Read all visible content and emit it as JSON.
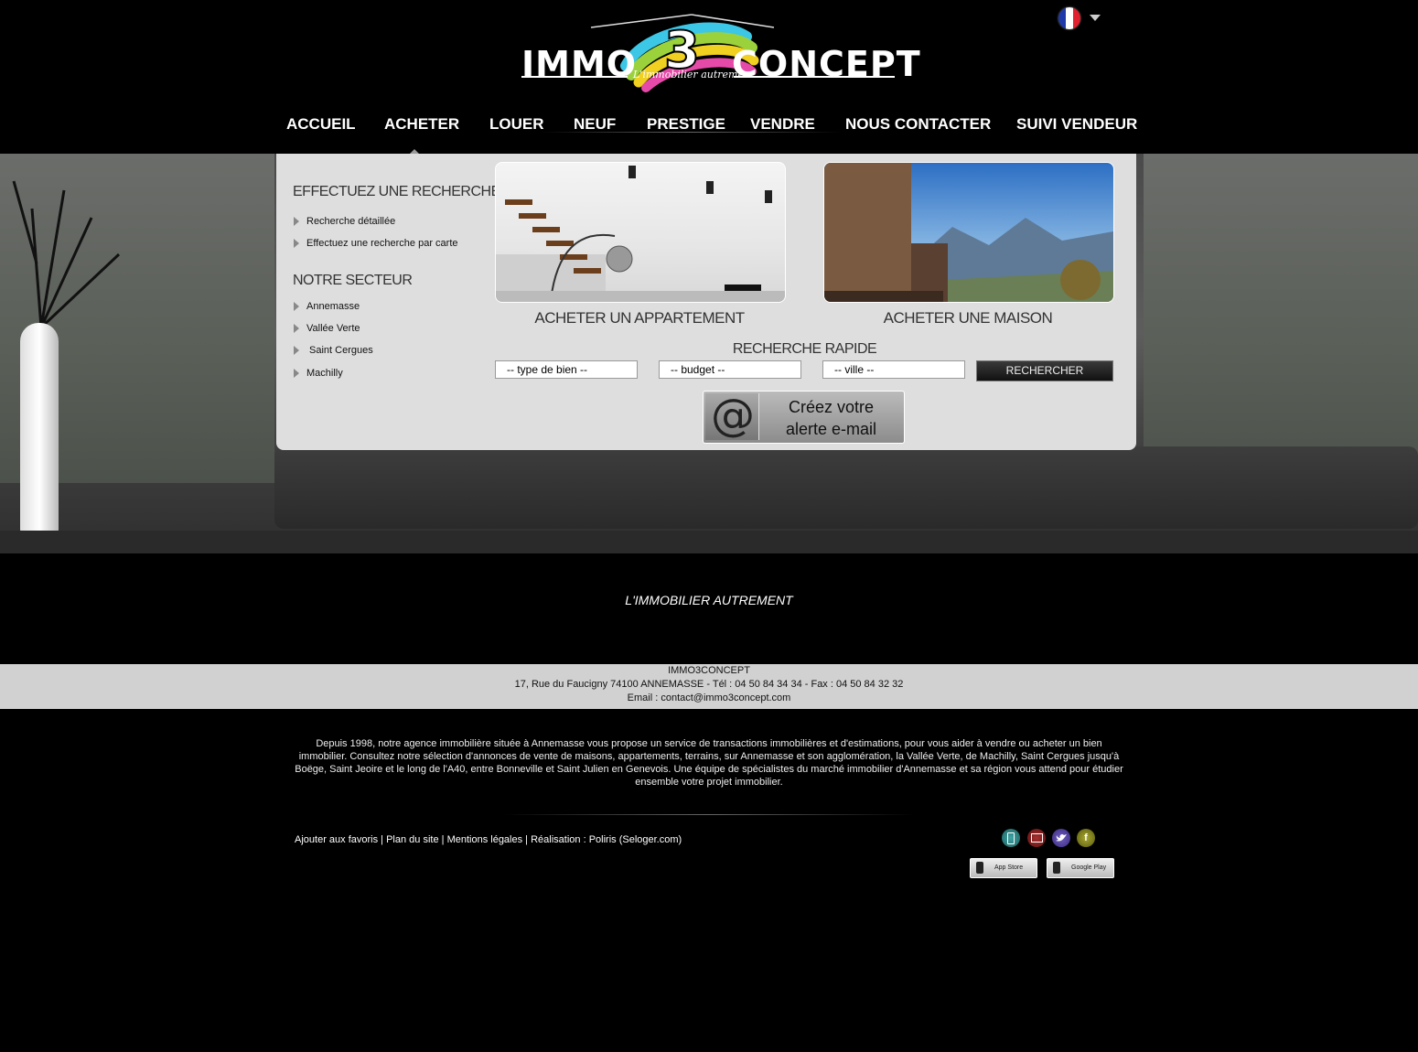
{
  "brand": {
    "word_left": "IMMO",
    "digit": "3",
    "word_right": "CONCEPT",
    "tagline": "L'immobilier autrement"
  },
  "language": {
    "icon": "flag-fr-icon",
    "colors": [
      "#1f3aa8",
      "#ffffff",
      "#e12030"
    ]
  },
  "nav": {
    "items": [
      {
        "label": "ACCUEIL"
      },
      {
        "label": "ACHETER",
        "active": true
      },
      {
        "label": "LOUER"
      },
      {
        "label": "NEUF"
      },
      {
        "label": "PRESTIGE"
      },
      {
        "label": "VENDRE"
      },
      {
        "label": "NOUS CONTACTER"
      },
      {
        "label": "SUIVI VENDEUR"
      }
    ]
  },
  "sidebar": {
    "search_title": "EFFECTUEZ UNE RECHERCHE",
    "search_links": [
      "Recherche détaillée",
      "Effectuez une recherche par carte"
    ],
    "sector_title": "NOTRE SECTEUR",
    "sector_links": [
      "Annemasse",
      "Vallée Verte",
      "Saint Cergues",
      "Machilly"
    ]
  },
  "cards": [
    {
      "label": "ACHETER UN APPARTEMENT"
    },
    {
      "label": "ACHETER UNE MAISON"
    }
  ],
  "quick_search": {
    "title": "RECHERCHE RAPIDE",
    "type": "-- type de bien --",
    "budget": "-- budget --",
    "city": "-- ville --",
    "button": "RECHERCHER"
  },
  "alert": {
    "line1": "Créez votre",
    "line2": "alerte e-mail"
  },
  "slogan": "L'IMMOBILIER AUTREMENT",
  "contact": {
    "name": "IMMO3CONCEPT",
    "address_line": "17, Rue du Faucigny 74100 ANNEMASSE  -  Tél : 04 50 84 34 34 - Fax : 04 50 84 32 32",
    "email_line": "Email : contact@immo3concept.com"
  },
  "about": "Depuis 1998, notre agence immobilière située à Annemasse vous propose un service de transactions immobilières et d'estimations, pour vous aider à vendre ou acheter un bien immobilier. Consultez notre sélection d'annonces de vente de maisons, appartements, terrains, sur Annemasse et son agglomération, la Vallée Verte, de Machilly, Saint Cergues jusqu'à Boëge, Saint Jeoire et le long de l'A40, entre Bonneville et Saint Julien en Genevois. Une équipe de spécialistes du marché immobilier d'Annemasse et sa région vous attend pour étudier ensemble votre projet immobilier.",
  "footer": {
    "links": [
      "Ajouter aux favoris",
      "Plan du site",
      "Mentions légales",
      "Réalisation : Poliris (Seloger.com)"
    ],
    "social": [
      {
        "icon": "mobile-icon",
        "color": "#2d8c8c"
      },
      {
        "icon": "tv-icon",
        "color": "#8a2020"
      },
      {
        "icon": "twitter-icon",
        "color": "#5a4aa0"
      },
      {
        "icon": "facebook-icon",
        "color": "#8a8a1a",
        "glyph": "f"
      }
    ],
    "stores": [
      {
        "icon": "apple-icon",
        "label": "App Store"
      },
      {
        "icon": "android-icon",
        "label": "Google Play"
      }
    ]
  },
  "colors": {
    "panel": "#dedede",
    "contact_bar": "#d1d1d1",
    "background": "#000000"
  }
}
